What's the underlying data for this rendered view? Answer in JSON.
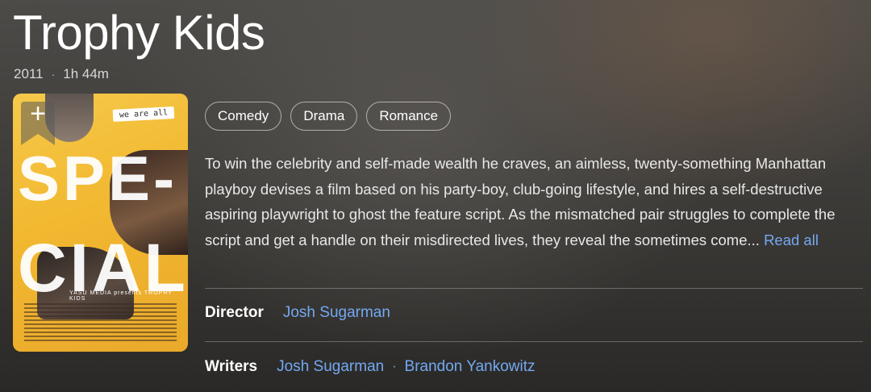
{
  "movie": {
    "title": "Trophy Kids",
    "year": "2011",
    "runtime": "1h 44m",
    "genres": [
      "Comedy",
      "Drama",
      "Romance"
    ],
    "description": "To win the celebrity and self-made wealth he craves, an aimless, twenty-something Manhattan playboy devises a film based on his party-boy, club-going lifestyle, and hires a self-destructive aspiring playwright to ghost the feature script. As the mismatched pair struggles to complete the script and get a handle on their misdirected lives, they reveal the sometimes come...",
    "read_all": "Read all",
    "director_label": "Director",
    "directors": [
      "Josh Sugarman"
    ],
    "writers_label": "Writers",
    "writers": [
      "Josh Sugarman",
      "Brandon Yankowitz"
    ]
  },
  "poster": {
    "tagline": "we are all",
    "big_text_1": "SPE-",
    "big_text_2": "CIAL",
    "studio_line": "YASU MEDIA presents TROPHY KIDS",
    "add_icon": "plus-icon"
  },
  "colors": {
    "link": "#74a8f2",
    "poster_yellow": "#f2b830"
  }
}
